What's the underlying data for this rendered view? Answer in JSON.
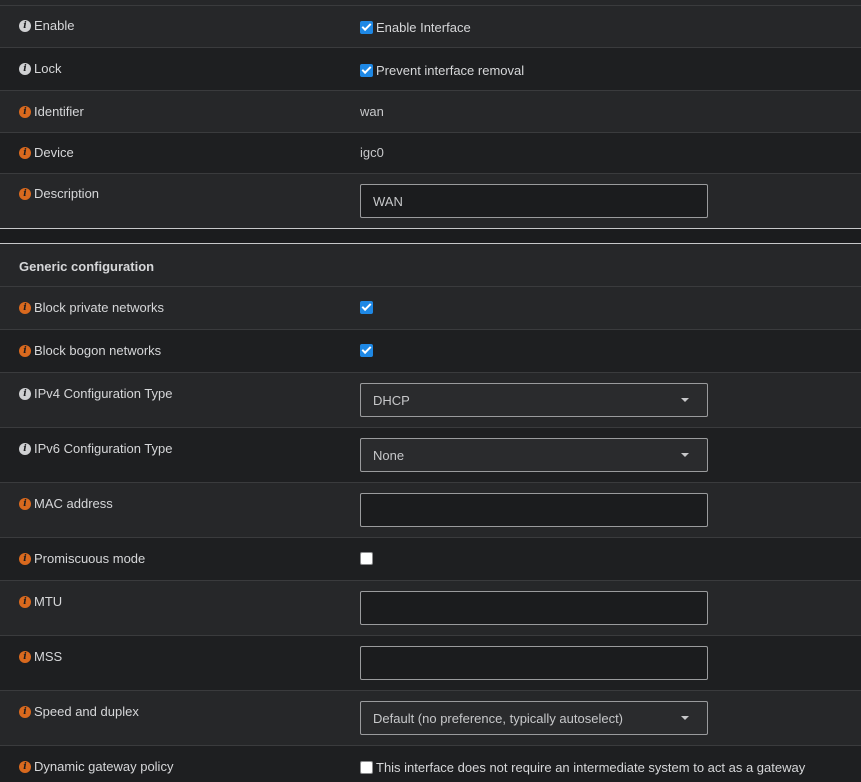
{
  "basic": {
    "enable": {
      "label": "Enable",
      "checkbox_label": "Enable Interface",
      "checked": true
    },
    "lock": {
      "label": "Lock",
      "checkbox_label": "Prevent interface removal",
      "checked": true
    },
    "identifier": {
      "label": "Identifier",
      "value": "wan"
    },
    "device": {
      "label": "Device",
      "value": "igc0"
    },
    "description": {
      "label": "Description",
      "value": "WAN"
    }
  },
  "generic": {
    "section_title": "Generic configuration",
    "block_private": {
      "label": "Block private networks",
      "checked": true
    },
    "block_bogon": {
      "label": "Block bogon networks",
      "checked": true
    },
    "ipv4_type": {
      "label": "IPv4 Configuration Type",
      "selected": "DHCP"
    },
    "ipv6_type": {
      "label": "IPv6 Configuration Type",
      "selected": "None"
    },
    "mac": {
      "label": "MAC address",
      "value": ""
    },
    "promiscuous": {
      "label": "Promiscuous mode",
      "checked": false
    },
    "mtu": {
      "label": "MTU",
      "value": ""
    },
    "mss": {
      "label": "MSS",
      "value": ""
    },
    "speed_duplex": {
      "label": "Speed and duplex",
      "selected": "Default (no preference, typically autoselect)"
    },
    "dyn_gateway": {
      "label": "Dynamic gateway policy",
      "checkbox_label": "This interface does not require an intermediate system to act as a gateway",
      "checked": false
    }
  },
  "colors": {
    "accent": "#1e88e5",
    "info_orange": "#d9691e",
    "background": "#1b1c1e"
  },
  "icons": {
    "info": "info-circle-icon",
    "caret": "caret-down-icon"
  }
}
